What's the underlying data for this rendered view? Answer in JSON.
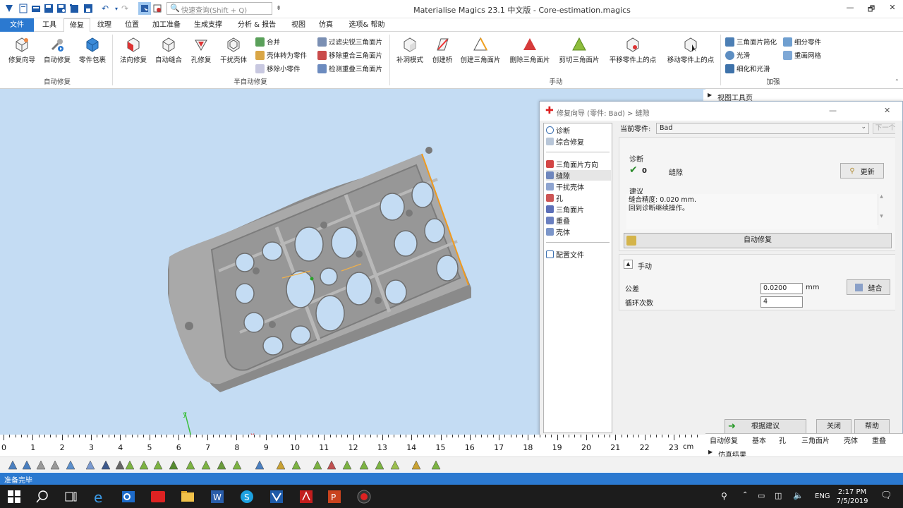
{
  "window": {
    "title": "Materialise Magics 23.1 中文版 - Core-estimation.magics",
    "quick_search_placeholder": "快速查询(Shift + Q)",
    "controls": [
      "—",
      "🗗",
      "✕"
    ]
  },
  "menu": {
    "tabs": [
      "文件",
      "工具",
      "修复",
      "纹理",
      "位置",
      "加工准备",
      "生成支撑",
      "分析 & 报告",
      "视图",
      "仿真",
      "选项& 帮助"
    ],
    "active": "修复"
  },
  "ribbon": {
    "groups": {
      "auto_repair": "自动修复",
      "semi_auto": "半自动修复",
      "manual": "手动",
      "enhance": "加强"
    },
    "big_buttons": [
      "修复向导",
      "自动修复",
      "零件包裹",
      "法向修复",
      "自动缝合",
      "孔修复",
      "干扰壳体",
      "补洞模式",
      "创建桥",
      "创建三角面片",
      "删除三角面片",
      "剪切三角面片",
      "平移零件上的点",
      "移动零件上的点"
    ],
    "small_buttons": {
      "col1": [
        "合并",
        "壳体转为零件",
        "移除小零件"
      ],
      "col2": [
        "过滤尖锐三角面片",
        "移除重合三角面片",
        "检测重叠三角面片"
      ],
      "col3": [
        "三角面片简化",
        "光滑",
        "细化和光滑"
      ],
      "col4": [
        "细分零件",
        "重画网格"
      ]
    }
  },
  "view_toolbar_label": "视图工具页",
  "dialog": {
    "title": "修复向导 (零件: Bad) > 缝隙",
    "nav": {
      "top": [
        "诊断",
        "综合修复"
      ],
      "middle": [
        "三角面片方向",
        "缝隙",
        "干扰壳体",
        "孔",
        "三角面片",
        "重叠",
        "壳体"
      ],
      "bottom": [
        "配置文件"
      ],
      "selected": "缝隙"
    },
    "current_part_label": "当前零件:",
    "current_part_value": "Bad",
    "next_label": "下一个",
    "diagnose": {
      "header": "诊断",
      "count": "0",
      "item": "缝隙",
      "refresh": "更新"
    },
    "suggestion": {
      "header": "建议",
      "line1": "缝合精度: 0.020 mm.",
      "line2": "回到诊断继续操作。"
    },
    "auto_repair_label": "自动修复",
    "manual": {
      "header": "手动",
      "tolerance_label": "公差",
      "tolerance_value": "0.0200",
      "unit": "mm",
      "iterations_label": "循环次数",
      "iterations_value": "4",
      "stitch_label": "缝合"
    },
    "footer": {
      "follow_advice": "根据建议",
      "close": "关闭",
      "help": "帮助"
    }
  },
  "ruler": {
    "labels": [
      "0",
      "1",
      "2",
      "3",
      "4",
      "5",
      "6",
      "7",
      "8",
      "9",
      "10",
      "11",
      "12",
      "13",
      "14",
      "15",
      "16",
      "17",
      "18",
      "19",
      "20",
      "21",
      "22",
      "23"
    ],
    "unit": "cm"
  },
  "right_panel_tabs": [
    "自动修复",
    "基本",
    "孔",
    "三角面片",
    "壳体",
    "重叠"
  ],
  "sim_results_label": "仿真结果",
  "status": "准备完毕",
  "taskbar": {
    "lang": "ENG",
    "time": "2:17 PM",
    "date": "7/5/2019"
  },
  "colors": {
    "accent": "#2b79d0",
    "viewport_bg": "#c4dcf3",
    "part_gray": "#8f8f8f",
    "edge_highlight": "#f09a1e"
  }
}
